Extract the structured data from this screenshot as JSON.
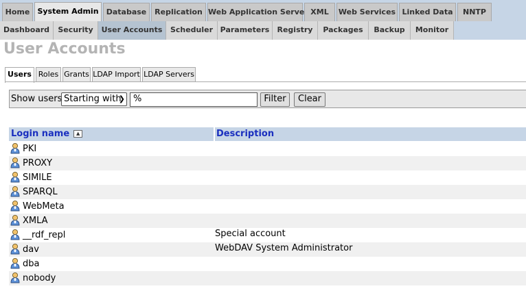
{
  "top_menu": [
    "Home",
    "System Admin",
    "Database",
    "Replication",
    "Web Application Server",
    "XML",
    "Web Services",
    "Linked Data",
    "NNTP"
  ],
  "sub_menu": [
    "Dashboard",
    "Security",
    "User Accounts",
    "Scheduler",
    "Parameters",
    "Registry",
    "Packages",
    "Backup",
    "Monitor"
  ],
  "page_title": "User Accounts",
  "inner_tabs": [
    "Users",
    "Roles",
    "Grants",
    "LDAP Import",
    "LDAP Servers"
  ],
  "filter": {
    "label": "Show users",
    "mode": "Starting with",
    "value": "%",
    "filter_button": "Filter",
    "clear_button": "Clear"
  },
  "table": {
    "columns": [
      "Login name",
      "Description"
    ],
    "rows": [
      {
        "login": "PKI",
        "description": ""
      },
      {
        "login": "PROXY",
        "description": ""
      },
      {
        "login": "SIMILE",
        "description": ""
      },
      {
        "login": "SPARQL",
        "description": ""
      },
      {
        "login": "WebMeta",
        "description": ""
      },
      {
        "login": "XMLA",
        "description": ""
      },
      {
        "login": "__rdf_repl",
        "description": "Special account"
      },
      {
        "login": "dav",
        "description": "WebDAV System Administrator"
      },
      {
        "login": "dba",
        "description": ""
      },
      {
        "login": "nobody",
        "description": ""
      }
    ]
  },
  "colors": {
    "nav_bg": "#c6d5e6",
    "header_link": "#1a2fbf",
    "title": "#b4b4b4"
  },
  "icons": {
    "user": "user-icon",
    "sort": "sort-ascending-icon"
  }
}
